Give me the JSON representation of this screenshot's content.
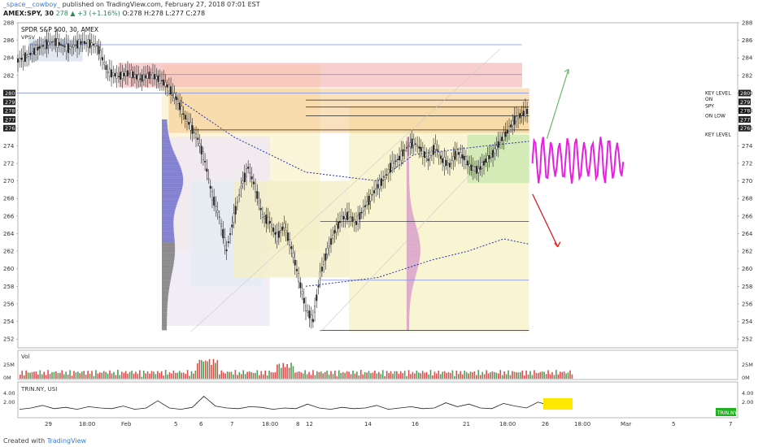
{
  "header": {
    "username": "_space__cowboy_",
    "published": "published on TradingView.com, February 27, 2018 07:01 EST",
    "symbol_line": "AMEX:SPY, 30",
    "change": "278 ▲ +3 (+1.16%)",
    "ohlc": "O:278 H:278 L:277 C:278"
  },
  "footer": {
    "created_with": "Created with",
    "brand": "TradingView"
  },
  "chart_data": [
    {
      "type": "candlestick",
      "title": "SPDR S&P 500, 30, AMEX",
      "subtitle": "VPSV",
      "ylim": [
        251,
        288
      ],
      "y_ticks": [
        252,
        254,
        256,
        258,
        260,
        262,
        264,
        266,
        268,
        270,
        272,
        274,
        276,
        278,
        280,
        282,
        284,
        286,
        288
      ],
      "x_ticks": [
        "29",
        "18:00",
        "Feb",
        "5",
        "6",
        "7",
        "18:00",
        "8",
        "12",
        "14",
        "16",
        "21",
        "18:00",
        "26",
        "18:00",
        "Mar",
        "5",
        "7"
      ],
      "last_price": 278,
      "price_labels": [
        {
          "price": 280,
          "text": "KEY LEVEL",
          "side": "right"
        },
        {
          "price": 279.3,
          "text": "ON",
          "side": "right"
        },
        {
          "price": 278.5,
          "text": "SPY",
          "side": "right"
        },
        {
          "price": 277.4,
          "text": "ON LOW",
          "side": "right"
        },
        {
          "price": 275.3,
          "text": "KEY LEVEL",
          "side": "right"
        }
      ],
      "axis_badges": [
        280,
        279,
        278,
        277,
        276
      ],
      "series": [
        {
          "name": "SPY",
          "points": [
            [
              0,
              283.7
            ],
            [
              3,
              284.3
            ],
            [
              6,
              285.2
            ],
            [
              10,
              285.9
            ],
            [
              14,
              285.1
            ],
            [
              18,
              285.8
            ],
            [
              22,
              285.4
            ],
            [
              25,
              282.4
            ],
            [
              28,
              281.9
            ],
            [
              31,
              282.3
            ],
            [
              34,
              281.6
            ],
            [
              37,
              282.1
            ],
            [
              40,
              281.4
            ],
            [
              42,
              280.6
            ],
            [
              44,
              279.4
            ],
            [
              46,
              277.6
            ],
            [
              48,
              276.2
            ],
            [
              50,
              274.8
            ],
            [
              52,
              272.2
            ],
            [
              54,
              268.3
            ],
            [
              56,
              265.9
            ],
            [
              58,
              262.1
            ],
            [
              60,
              265.8
            ],
            [
              62,
              269.3
            ],
            [
              64,
              271.5
            ],
            [
              66,
              269.2
            ],
            [
              68,
              266.0
            ],
            [
              70,
              265.3
            ],
            [
              72,
              263.6
            ],
            [
              74,
              264.9
            ],
            [
              76,
              262.4
            ],
            [
              78,
              259.0
            ],
            [
              80,
              255.5
            ],
            [
              82,
              254.1
            ],
            [
              84,
              259.3
            ],
            [
              86,
              262.0
            ],
            [
              88,
              264.2
            ],
            [
              90,
              265.7
            ],
            [
              92,
              266.1
            ],
            [
              94,
              265.2
            ],
            [
              96,
              266.8
            ],
            [
              98,
              268.1
            ],
            [
              100,
              269.4
            ],
            [
              102,
              270.3
            ],
            [
              104,
              271.9
            ],
            [
              106,
              272.6
            ],
            [
              108,
              273.8
            ],
            [
              110,
              274.4
            ],
            [
              112,
              273.6
            ],
            [
              114,
              272.4
            ],
            [
              116,
              273.9
            ],
            [
              118,
              272.3
            ],
            [
              120,
              271.8
            ],
            [
              122,
              273.3
            ],
            [
              124,
              272.6
            ],
            [
              126,
              271.5
            ],
            [
              128,
              271.2
            ],
            [
              130,
              272.3
            ],
            [
              132,
              273.1
            ],
            [
              134,
              274.5
            ],
            [
              136,
              275.6
            ],
            [
              138,
              276.9
            ],
            [
              140,
              277.6
            ],
            [
              142,
              278.0
            ]
          ]
        }
      ],
      "annotations": {
        "zones": [
          {
            "label": "red resistance zone",
            "from": 280.7,
            "to": 283.4,
            "color": "#f4a7a7"
          },
          {
            "label": "orange supply zone",
            "from": 275.5,
            "to": 280.5,
            "color": "#f7c98a"
          },
          {
            "label": "green consolidation zone",
            "from": 269.8,
            "to": 275.2,
            "color": "#b6e3a3"
          }
        ],
        "horizontal_levels": [
          285.5,
          282.1,
          280.0,
          279.2,
          278.4,
          277.4,
          275.8,
          265.4,
          258.7,
          253.0
        ],
        "arrow_up_target": 282.7,
        "arrow_down_target": 262.5
      },
      "vwap_upper": [
        [
          42,
          280
        ],
        [
          60,
          275
        ],
        [
          80,
          271
        ],
        [
          100,
          270
        ],
        [
          110,
          273
        ],
        [
          130,
          274
        ],
        [
          142,
          274.5
        ]
      ],
      "vwap_lower": [
        [
          80,
          258
        ],
        [
          100,
          259
        ],
        [
          115,
          261
        ],
        [
          125,
          262
        ],
        [
          135,
          263.4
        ],
        [
          142,
          262.8
        ]
      ]
    },
    {
      "type": "bar",
      "title": "Vol",
      "y_ticks": [
        "25M",
        "0M"
      ],
      "colors": {
        "up": "#4d9e5a",
        "down": "#e24c4c"
      }
    },
    {
      "type": "line",
      "title": "TRIN.NY, USI",
      "y_ticks": [
        "4.00",
        "2.00"
      ],
      "badge": "TRIN.NY",
      "series": [
        {
          "name": "TRIN.NY",
          "values": [
            0.8,
            1.0,
            1.4,
            0.9,
            1.1,
            0.8,
            1.2,
            1.0,
            0.9,
            1.3,
            0.8,
            1.0,
            2.1,
            1.0,
            0.8,
            1.1,
            2.8,
            1.3,
            1.0,
            0.9,
            1.2,
            1.1,
            0.8,
            1.0,
            0.9,
            1.6,
            1.0,
            0.8,
            1.1,
            0.9,
            1.0,
            1.4,
            0.8,
            1.0,
            1.2,
            0.9,
            1.0,
            1.8,
            1.2,
            1.6,
            1.0,
            0.9,
            1.7,
            1.3,
            1.0,
            1.9,
            1.4,
            1.2,
            1.0
          ]
        }
      ]
    }
  ]
}
